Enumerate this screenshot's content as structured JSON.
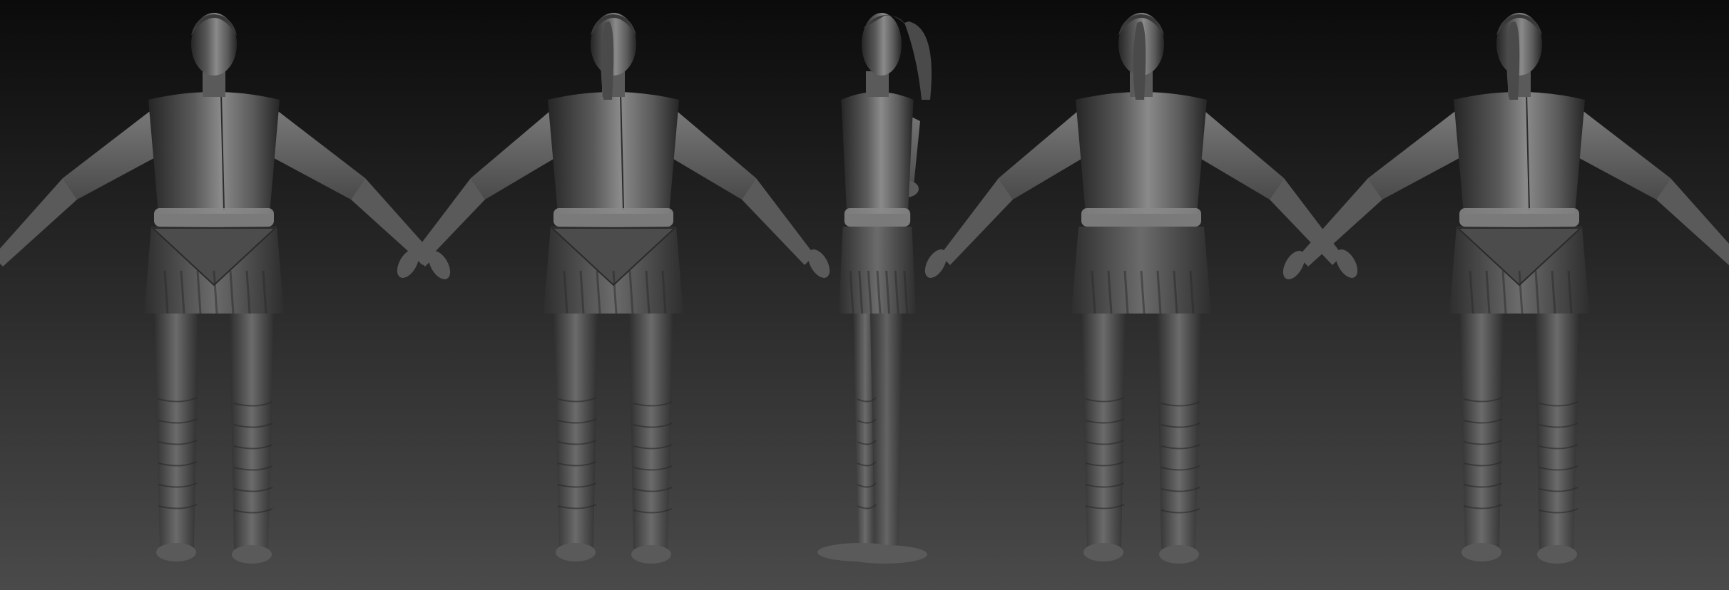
{
  "scene": {
    "kind": "turnaround-render",
    "background": {
      "top_color": "#0b0b0b",
      "bottom_color": "#4a4a4a"
    },
    "material": {
      "base": "#5a5a5a",
      "highlight": "#8a8a8a",
      "shadow": "#262626"
    },
    "views": [
      {
        "name": "front"
      },
      {
        "name": "three-quarter-front"
      },
      {
        "name": "side"
      },
      {
        "name": "three-quarter-back"
      },
      {
        "name": "back"
      }
    ]
  }
}
